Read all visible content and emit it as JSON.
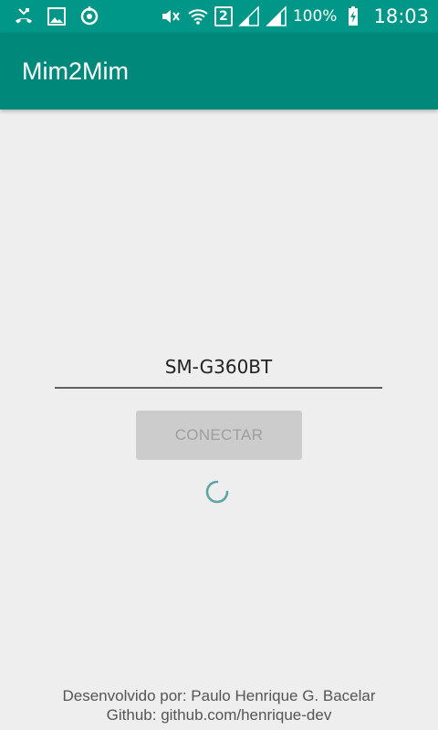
{
  "status_bar": {
    "icons_left": [
      "missed-call-icon",
      "gallery-icon",
      "sync-icon"
    ],
    "icons_right": [
      "mute-icon",
      "wifi-icon",
      "sim-2-icon",
      "signal-icon",
      "signal-2-icon",
      "battery-charging-icon"
    ],
    "sim_label": "2",
    "battery": "100%",
    "time": "18:03"
  },
  "app_bar": {
    "title": "Mim2Mim"
  },
  "main": {
    "device_input_value": "SM-G360BT",
    "connect_label": "CONECTAR"
  },
  "footer": {
    "developer": "Desenvolvido por: Paulo Henrique G. Bacelar",
    "github": "Github: github.com/henrique-dev"
  },
  "colors": {
    "status_bar": "#009688",
    "app_bar": "#00897b",
    "background": "#eeeeee",
    "button_disabled": "#cccccc",
    "spinner": "#5fa3a5"
  }
}
